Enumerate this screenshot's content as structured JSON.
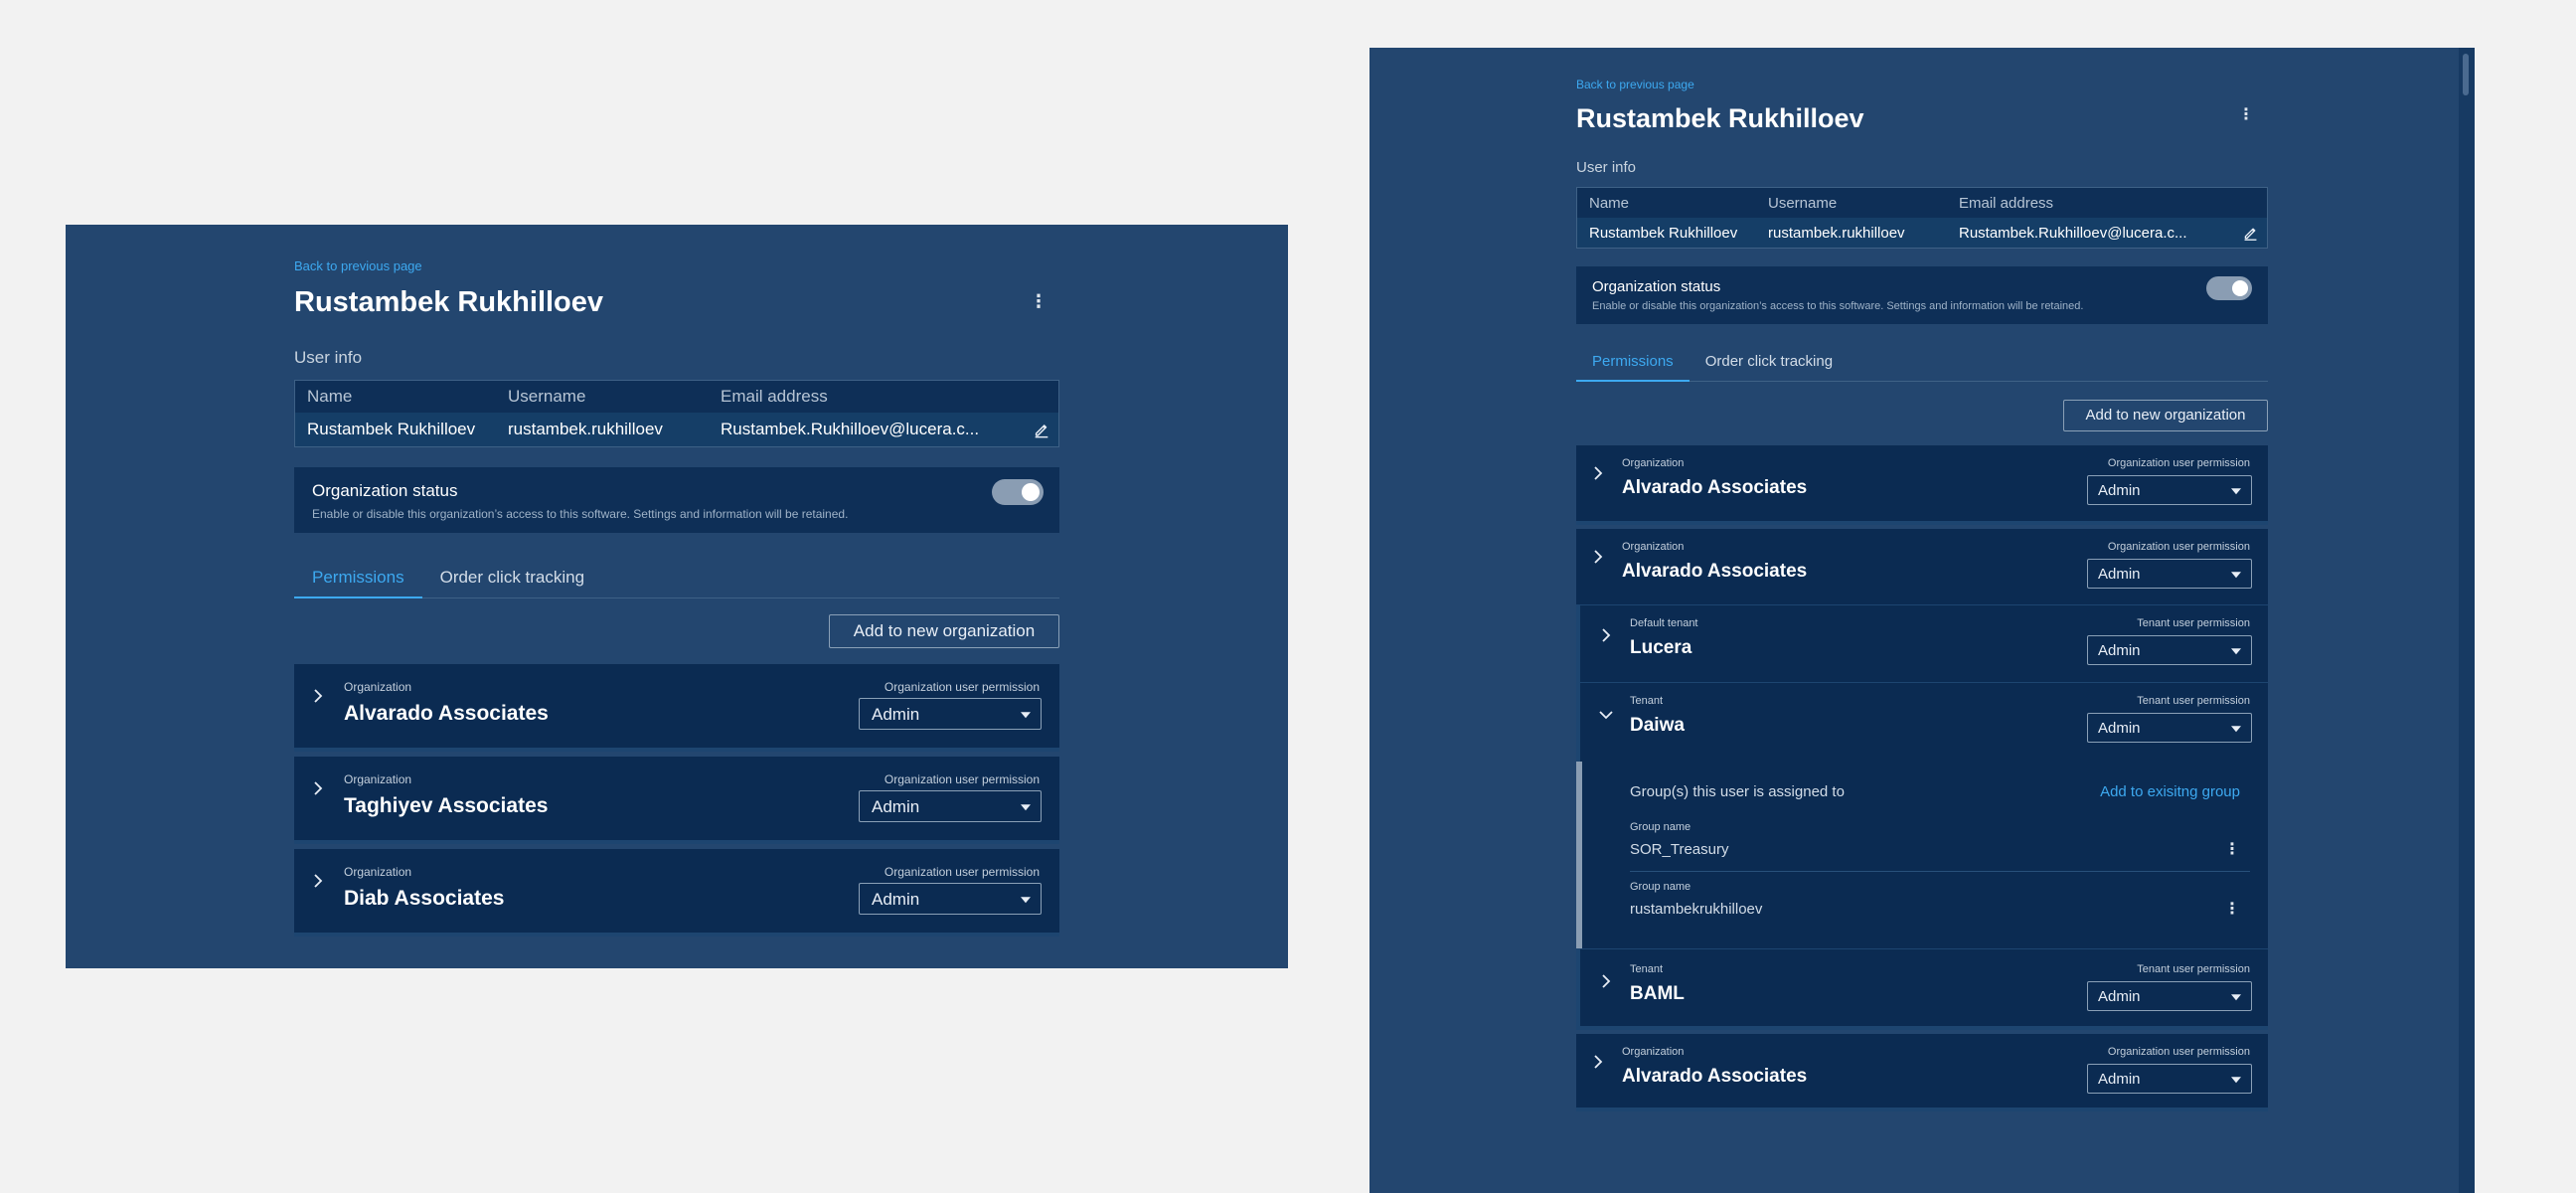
{
  "back_link": "Back to previous page",
  "user_name": "Rustambek Rukhilloev",
  "more_icon": "kebab-vertical-icon",
  "user_info": {
    "label": "User info",
    "headers": [
      "Name",
      "Username",
      "Email address"
    ],
    "values": [
      "Rustambek Rukhilloev",
      "rustambek.rukhilloev",
      "Rustambek.Rukhilloev@lucera.c..."
    ],
    "edit_icon": "pencil-icon"
  },
  "org_status": {
    "title": "Organization status",
    "description": "Enable or disable this organization’s access to this software. Settings and information will be retained.",
    "enabled": true
  },
  "tabs": [
    {
      "label": "Permissions",
      "active": true
    },
    {
      "label": "Order click tracking",
      "active": false
    }
  ],
  "add_org_button": "Add to new organization",
  "org_label": "Organization",
  "org_perm_label": "Organization user permission",
  "tenant_perm_label": "Tenant user permission",
  "default_tenant_label": "Default tenant",
  "tenant_label": "Tenant",
  "perm_value": "Admin",
  "left_orgs": [
    "Alvarado Associates",
    "Taghiyev Associates",
    "Diab Associates"
  ],
  "right": {
    "org1": "Alvarado Associates",
    "org2": "Alvarado Associates",
    "tenants": [
      "Lucera",
      "Daiwa",
      "BAML"
    ],
    "groups_title": "Group(s) this user is assigned to",
    "add_group_link": "Add to exisitng group",
    "group_name_label": "Group name",
    "groups": [
      "SOR_Treasury",
      "rustambekrukhilloev"
    ],
    "org3": "Alvarado Associates"
  },
  "colors": {
    "panel_bg": "#23466f",
    "card_bg": "#0b2b52",
    "accent": "#3da9f0",
    "page_bg": "#f2f2f2"
  }
}
